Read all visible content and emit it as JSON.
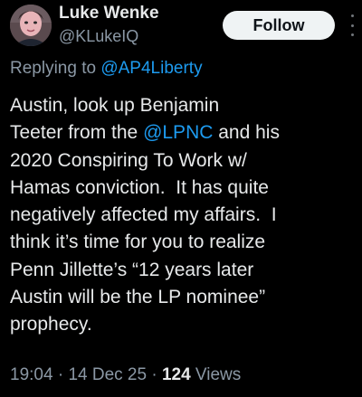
{
  "author": {
    "display_name": "Luke Wenke",
    "handle": "@KLukeIQ"
  },
  "follow_button": {
    "label": "Follow"
  },
  "reply_context": {
    "prefix": "Replying to ",
    "mention": "@AP4Liberty"
  },
  "tweet_text": {
    "line1": "Austin, look up Benjamin",
    "line2_before": "Teeter from the ",
    "line2_mention": "@LPNC",
    "line2_after": " and his",
    "line3": "2020 Conspiring To Work w/",
    "line4": "Hamas conviction.  It has quite",
    "line5": "negatively affected my affairs.  I",
    "line6": "think it’s time for you to realize",
    "line7": "Penn Jillette’s “12 years later",
    "line8": "Austin will be the LP nominee”",
    "line9": "prophecy."
  },
  "meta": {
    "time": "19:04",
    "separator1": " · ",
    "date": "14 Dec 25",
    "separator2": " · ",
    "views_count": "124",
    "views_label": " Views"
  },
  "colors": {
    "background": "#000000",
    "text": "#e7e9ea",
    "secondary": "#8b98a5",
    "link": "#1d9bf0",
    "follow_bg": "#eff3f4"
  },
  "icons": {
    "more": "more-options-icon",
    "avatar": "avatar"
  }
}
